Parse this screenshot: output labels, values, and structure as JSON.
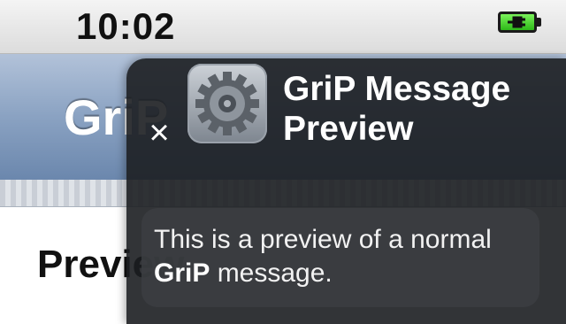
{
  "status_bar": {
    "time": "10:02",
    "battery_icon": "battery-charging-icon",
    "battery_color": "#2db818"
  },
  "background_app": {
    "nav_title": "GriP",
    "section_heading": "Preview",
    "nav_color": "#8aa2c2"
  },
  "notification": {
    "close_label": "×",
    "app_icon": "gear-settings-icon",
    "title": "GriP Message Preview",
    "message_prefix": "This is a preview of a normal ",
    "message_bold": "GriP",
    "message_suffix": " message."
  }
}
